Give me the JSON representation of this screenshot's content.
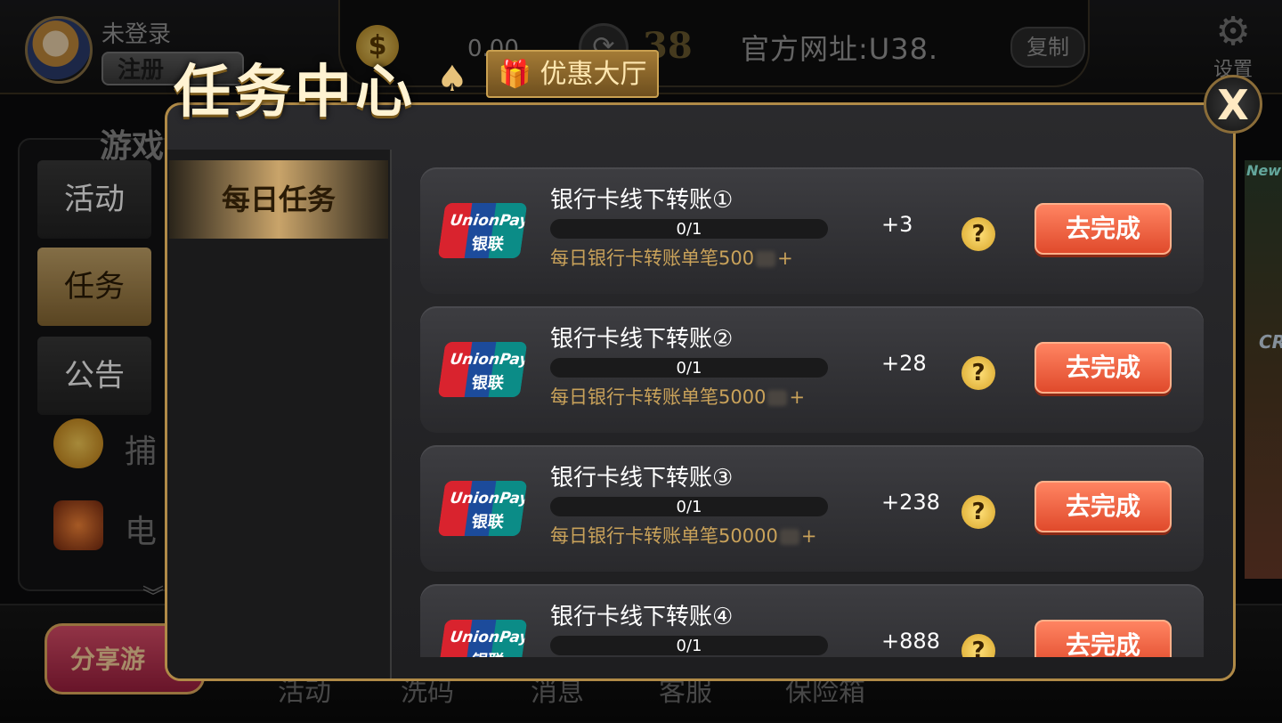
{
  "header": {
    "login_status": "未登录",
    "register_label": "注册",
    "balance": "0.00",
    "coin_symbol": "$",
    "logo_text": "38",
    "official_url_label": "官方网址:U38.",
    "copy_label": "复制",
    "settings_label": "设置"
  },
  "left_panel": {
    "title": "游戏",
    "tabs": [
      {
        "label": "活动",
        "active": false
      },
      {
        "label": "任务",
        "active": true
      },
      {
        "label": "公告",
        "active": false
      }
    ],
    "items": [
      "捕",
      "电"
    ]
  },
  "bottom_bar": {
    "share_label": "分享游",
    "nav": [
      "活动",
      "洗码",
      "消息",
      "客服",
      "保险箱"
    ]
  },
  "right_game": {
    "new_tag": "New",
    "label": "CR"
  },
  "modal": {
    "title": "任务中心",
    "promo_tab": "优惠大厅",
    "close_label": "X",
    "category_tabs": [
      {
        "label": "每日任务",
        "active": true
      }
    ],
    "tasks": [
      {
        "name": "银行卡线下转账①",
        "progress_text": "0/1",
        "progress": 0,
        "reward": "+3",
        "description": "每日银行卡转账单笔500",
        "desc_suffix": "+",
        "button": "去完成"
      },
      {
        "name": "银行卡线下转账②",
        "progress_text": "0/1",
        "progress": 0,
        "reward": "+28",
        "description": "每日银行卡转账单笔5000",
        "desc_suffix": "+",
        "button": "去完成"
      },
      {
        "name": "银行卡线下转账③",
        "progress_text": "0/1",
        "progress": 0,
        "reward": "+238",
        "description": "每日银行卡转账单笔50000",
        "desc_suffix": "+",
        "button": "去完成"
      },
      {
        "name": "银行卡线下转账④",
        "progress_text": "0/1",
        "progress": 0,
        "reward": "+888",
        "description": "",
        "desc_suffix": "",
        "button": "去完成"
      }
    ],
    "payment_logo": {
      "line1": "UnionPay",
      "line2": "银联"
    },
    "help_icon_text": "?"
  }
}
